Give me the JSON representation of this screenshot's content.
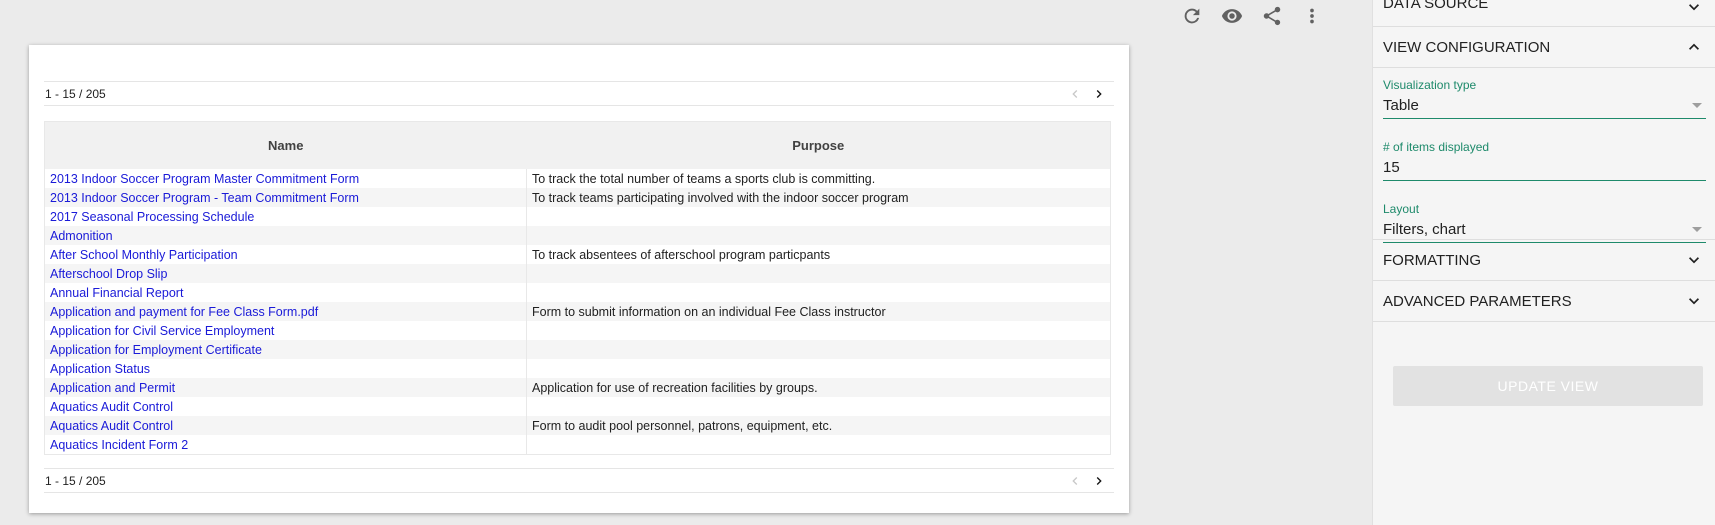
{
  "toolbar": {
    "icons": [
      "refresh-icon",
      "eye-icon",
      "share-icon",
      "more-vert-icon"
    ]
  },
  "table": {
    "pager_text": "1 - 15 / 205",
    "columns": [
      "Name",
      "Purpose"
    ],
    "rows": [
      {
        "name": "2013 Indoor Soccer Program Master Commitment Form",
        "purpose": "To track the total number of teams a sports club is committing."
      },
      {
        "name": "2013 Indoor Soccer Program - Team Commitment Form",
        "purpose": "To track teams participating involved with the indoor soccer program"
      },
      {
        "name": "2017 Seasonal Processing Schedule",
        "purpose": ""
      },
      {
        "name": "Admonition",
        "purpose": ""
      },
      {
        "name": "After School Monthly Participation",
        "purpose": "To track absentees of afterschool program particpants"
      },
      {
        "name": "Afterschool Drop Slip",
        "purpose": ""
      },
      {
        "name": "Annual Financial Report",
        "purpose": ""
      },
      {
        "name": "Application and payment for Fee Class Form.pdf",
        "purpose": "Form to submit information on an individual Fee Class instructor"
      },
      {
        "name": "Application for Civil Service Employment",
        "purpose": ""
      },
      {
        "name": "Application for Employment Certificate",
        "purpose": ""
      },
      {
        "name": "Application Status",
        "purpose": ""
      },
      {
        "name": "Application and Permit",
        "purpose": "Application for use of recreation facilities by groups."
      },
      {
        "name": "Aquatics Audit Control",
        "purpose": ""
      },
      {
        "name": "Aquatics Audit Control",
        "purpose": "Form to audit pool personnel, patrons, equipment, etc."
      },
      {
        "name": "Aquatics Incident Form 2",
        "purpose": ""
      }
    ]
  },
  "panel": {
    "data_source": "DATA SOURCE",
    "view_configuration": "VIEW CONFIGURATION",
    "visualization_type_label": "Visualization type",
    "visualization_type_value": "Table",
    "items_displayed_label": "# of items displayed",
    "items_displayed_value": "15",
    "layout_label": "Layout",
    "layout_value": "Filters, chart",
    "formatting": "FORMATTING",
    "advanced_parameters": "ADVANCED PARAMETERS",
    "update_button": "UPDATE VIEW"
  },
  "colors": {
    "link": "#1a1ad8",
    "accent": "#1e8a6b",
    "background": "#ebebeb"
  }
}
